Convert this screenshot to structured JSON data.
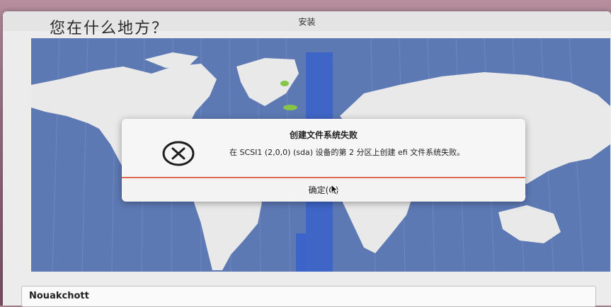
{
  "window": {
    "title": "安装"
  },
  "page": {
    "title": "您在什么地方？"
  },
  "dialog": {
    "title": "创建文件系统失败",
    "message": "在 SCSI1 (2,0,0) (sda) 设备的第 2 分区上创建 efi 文件系统失败。",
    "ok_label": "确定(O)",
    "icon": "error-icon"
  },
  "location": {
    "value": "Nouakchott"
  },
  "colors": {
    "ocean": "#5d79b4",
    "land": "#e9e9e9",
    "timezone_highlight": "#3c63c9",
    "dialog_separator": "#e06a50"
  }
}
